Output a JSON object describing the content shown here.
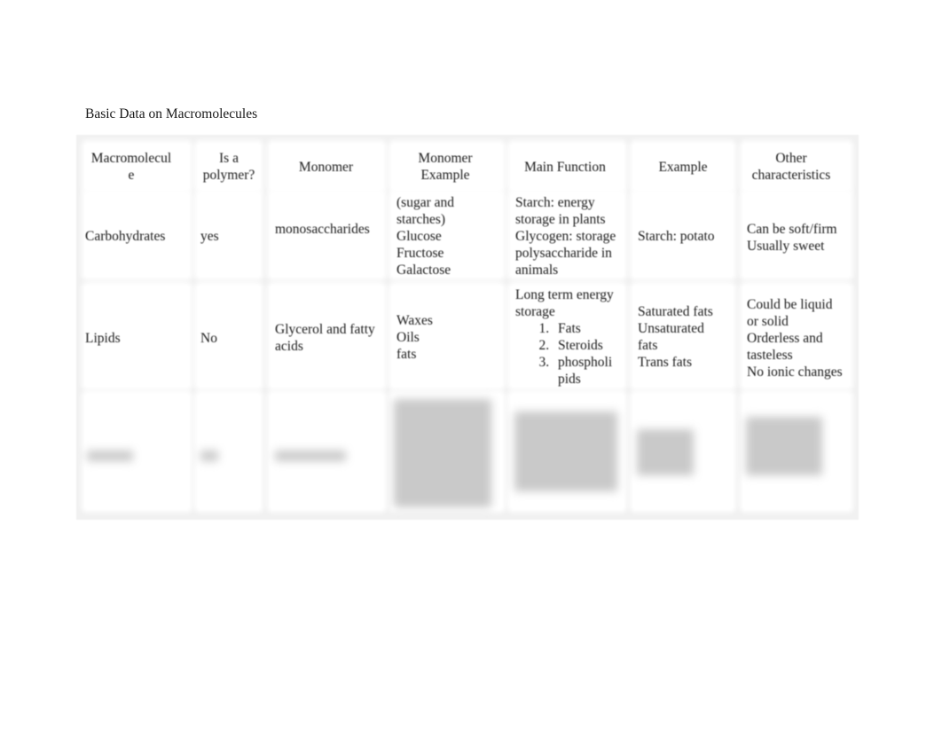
{
  "document": {
    "title": "Basic Data on Macromolecules"
  },
  "table": {
    "headers": [
      "Macromolecul\ne",
      "Is a\npolymer?",
      "Monomer",
      "Monomer\nExample",
      "Main Function",
      "Example",
      "Other\ncharacteristics"
    ],
    "rows": [
      {
        "macromolecule": "Carbohydrates",
        "is_polymer": "yes",
        "monomer": "monosaccharides",
        "monomer_example": "(sugar and\nstarches)\nGlucose\nFructose\nGalactose",
        "main_function": "Starch: energy\nstorage in plants\nGlycogen: storage\npolysaccharide in\nanimals",
        "example": "Starch: potato",
        "other": "Can be soft/firm\nUsually sweet"
      },
      {
        "macromolecule": "Lipids",
        "is_polymer": "No",
        "monomer": "Glycerol and fatty\nacids",
        "monomer_example": "Waxes\nOils\nfats",
        "main_function": "Long term energy\nstorage",
        "main_function_list": [
          "Fats",
          "Steroids",
          "phospholi\npids"
        ],
        "example": "Saturated fats\nUnsaturated\nfats\nTrans fats",
        "other": "Could be liquid\nor solid\nOrderless and\ntasteless\nNo ionic changes"
      },
      {
        "blurred": true
      }
    ]
  }
}
